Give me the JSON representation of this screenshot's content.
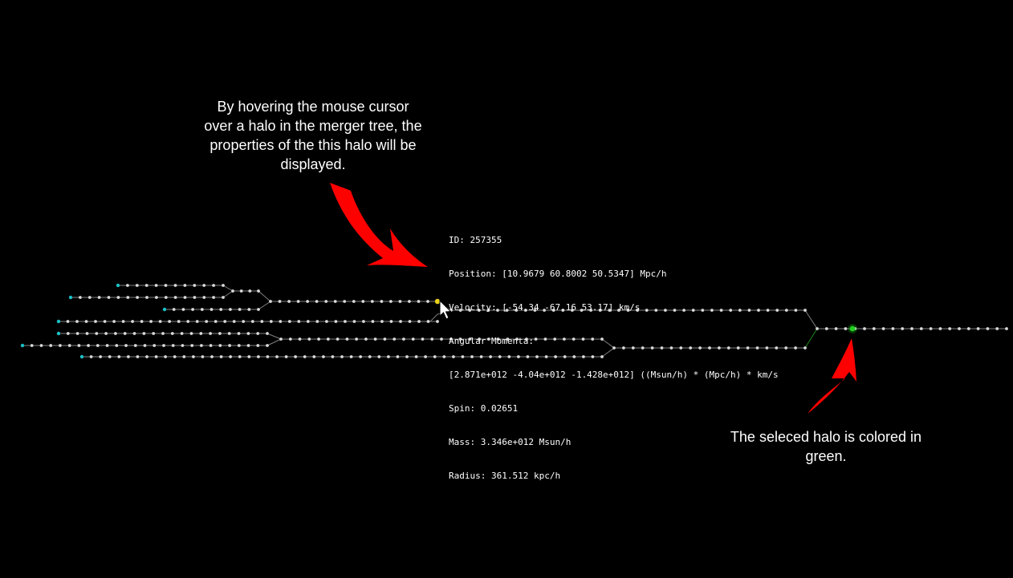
{
  "colors": {
    "background": "#000000",
    "node": "#d9d9d9",
    "edge": "#7f7f7f",
    "leaf_node": "#19c2c8",
    "hovered_node": "#e8d21a",
    "selected_node": "#1fd11f",
    "selected_edge": "#1b8a1b",
    "annotation_arrow": "#ff0000"
  },
  "annotations": {
    "hover_note": "By hovering the mouse cursor\nover a halo in the merger tree, the\nproperties of the this halo will be\ndisplayed.",
    "selected_note": "The seleced halo is colored in\ngreen."
  },
  "tooltip": {
    "lines": [
      "ID: 257355",
      "Position: [10.9679 60.8002 50.5347] Mpc/h",
      "Velocity: [-54.34 -67.16 53.17] km/s",
      "Angular Momenta:",
      "[2.871e+012 -4.04e+012 -1.428e+012] ((Msun/h) * (Mpc/h) * km/s",
      "Spin: 0.02651",
      "Mass: 3.346e+012 Msun/h",
      "Radius: 361.512 kpc/h"
    ]
  },
  "icons": {
    "cursor": "mouse-pointer-icon",
    "hover_arrow": "red-arrow-icon",
    "selected_arrow": "red-arrow-icon"
  }
}
